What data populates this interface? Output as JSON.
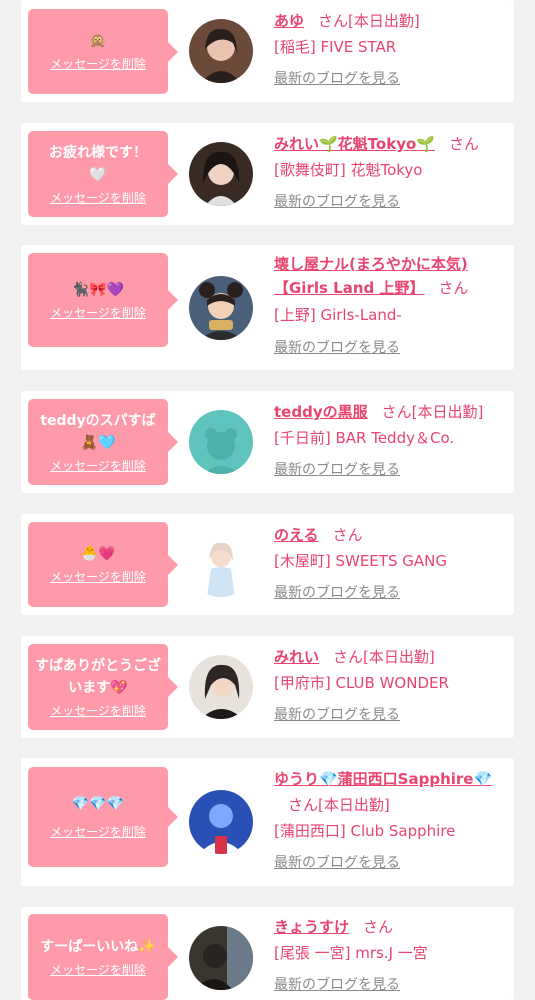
{
  "delete_label": "メッセージを削除",
  "blog_label": "最新のブログを見る",
  "items": [
    {
      "message": "🙊",
      "name": "あゆ",
      "suffix": "さん[本日出勤]",
      "shop": "[稲毛] FIVE STAR",
      "avatar_color": "#6b4a3a"
    },
    {
      "message": "お疲れ様です！🤍",
      "name": "みれい🌱花魁Tokyo🌱",
      "suffix": "さん",
      "shop": "[歌舞伎町] 花魁Tokyo",
      "avatar_color": "#3a2a24"
    },
    {
      "message": "🐈‍⬛🎀💜",
      "name": "壊し屋ナル(まろやかに本気)【Girls Land 上野】",
      "suffix": "さん",
      "shop": "[上野] Girls-Land-",
      "avatar_color": "#4a5f7a"
    },
    {
      "message": "teddyのスパすば🧸🩵",
      "name": "teddyの黒服",
      "suffix": "さん[本日出勤]",
      "shop": "[千日前] BAR Teddy＆Co.",
      "avatar_color": "#5ec4bd"
    },
    {
      "message": "🐣💗",
      "name": "のえる",
      "suffix": "さん",
      "shop": "[木屋町] SWEETS GANG",
      "avatar_color": "#f4f4f8"
    },
    {
      "message": "すぱありがとうございます💖",
      "name": "みれい",
      "suffix": "さん[本日出勤]",
      "shop": "[甲府市] CLUB WONDER",
      "avatar_color": "#2e2624"
    },
    {
      "message": "💎💎💎",
      "name": "ゆうり💎蒲田西口Sapphire💎",
      "suffix": "さん[本日出勤]",
      "shop": "[蒲田西口] Club Sapphire",
      "avatar_color": "#2a4fb5"
    },
    {
      "message": "すーぱーいいね✨",
      "name": "きょうすけ",
      "suffix": "さん",
      "shop": "[尾張 一宮] mrs.J 一宮",
      "avatar_color": "#3b3530"
    }
  ]
}
